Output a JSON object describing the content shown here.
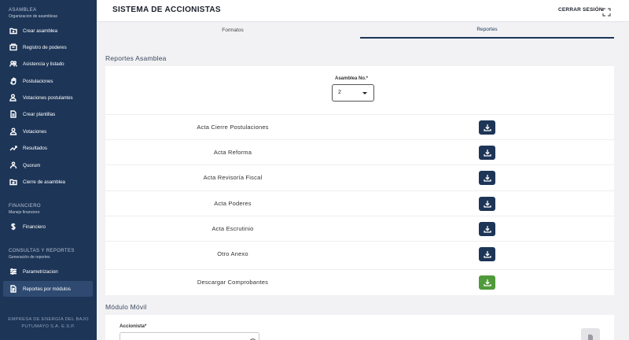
{
  "sidebar": {
    "sections": [
      {
        "title": "ASAMBLEA",
        "subtitle": "Organizacion de asambleas"
      },
      {
        "title": "FINANCIERO",
        "subtitle": "Manejo financiero"
      },
      {
        "title": "CONSULTAS Y REPORTES",
        "subtitle": "Generación de reportes"
      }
    ],
    "items": [
      {
        "label": "Crear asamblea",
        "icon": "folder-add-icon"
      },
      {
        "label": "Registro de poderes",
        "icon": "document-stack-icon"
      },
      {
        "label": "Asistencia y listado",
        "icon": "users-icon"
      },
      {
        "label": "Postulaciones",
        "icon": "hand-icon"
      },
      {
        "label": "Votaciones postulantes",
        "icon": "user-check-icon"
      },
      {
        "label": "Crear plantillas",
        "icon": "file-icon"
      },
      {
        "label": "Votaciones",
        "icon": "vote-icon"
      },
      {
        "label": "Resultados",
        "icon": "chart-line-icon"
      },
      {
        "label": "Quorum",
        "icon": "people-icon"
      },
      {
        "label": "Cierre de asamblea",
        "icon": "folder-close-icon"
      },
      {
        "label": "Financiero",
        "icon": "dollar-icon"
      },
      {
        "label": "Parametrizacion",
        "icon": "sliders-icon"
      },
      {
        "label": "Reportes por módulos",
        "icon": "report-icon",
        "active": true
      }
    ],
    "company": [
      "EMPRESA DE ENERGÍA DEL BAJO",
      "PUTUMAYO S.A. E.S.P."
    ]
  },
  "header": {
    "title": "SISTEMA DE ACCIONISTAS",
    "logout_label": "CERRAR SESIÓN"
  },
  "tabs": [
    {
      "label": "Formatos",
      "active": false
    },
    {
      "label": "Reportes",
      "active": true
    }
  ],
  "reportes": {
    "title": "Reportes Asamblea",
    "asamblea_label": "Asamblea No.*",
    "asamblea_value": "2",
    "rows": [
      {
        "label": "Acta Cierre Postulaciones",
        "button": "download-icon",
        "color": "#1d3557"
      },
      {
        "label": "Acta Reforma",
        "button": "download-icon",
        "color": "#1d3557"
      },
      {
        "label": "Acta Revisoría Fiscal",
        "button": "download-icon",
        "color": "#1d3557"
      },
      {
        "label": "Acta Poderes",
        "button": "download-icon",
        "color": "#1d3557"
      },
      {
        "label": "Acta Escrutinio",
        "button": "download-icon",
        "color": "#1d3557"
      },
      {
        "label": "Otro Anexo",
        "button": "download-icon",
        "color": "#1d3557"
      },
      {
        "label": "Descargar Comprobantes",
        "button": "download-icon",
        "color": "#4f9a3a"
      }
    ]
  },
  "movil": {
    "title": "Módulo Móvil",
    "accionista_label": "Accionista*"
  }
}
